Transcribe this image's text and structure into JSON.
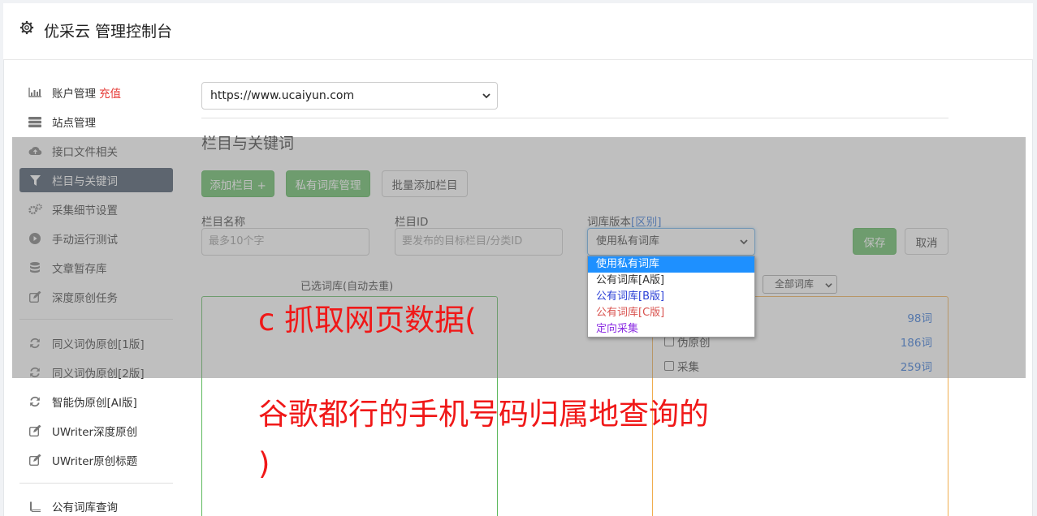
{
  "header": {
    "title": "优采云 管理控制台"
  },
  "sidebar": {
    "items": [
      {
        "label": "账户管理",
        "extra": "充值",
        "icon": "bar-chart-icon"
      },
      {
        "label": "站点管理",
        "icon": "server-icon"
      },
      {
        "label": "接口文件相关",
        "icon": "cloud-upload-icon"
      },
      {
        "label": "栏目与关键词",
        "icon": "filter-icon",
        "active": true
      },
      {
        "label": "采集细节设置",
        "icon": "gears-icon"
      },
      {
        "label": "手动运行测试",
        "icon": "play-circle-icon"
      },
      {
        "label": "文章暂存库",
        "icon": "database-icon"
      },
      {
        "label": "深度原创任务",
        "icon": "edit-icon"
      },
      {
        "label": "同义词伪原创[1版]",
        "icon": "refresh-icon"
      },
      {
        "label": "同义词伪原创[2版]",
        "icon": "refresh-icon"
      },
      {
        "label": "智能伪原创[AI版]",
        "icon": "refresh-icon"
      },
      {
        "label": "UWriter深度原创",
        "icon": "edit-icon"
      },
      {
        "label": "UWriter原创标题",
        "icon": "edit-icon"
      },
      {
        "label": "公有词库查询",
        "icon": "book-icon"
      }
    ]
  },
  "site_select": {
    "value": "https://www.ucaiyun.com"
  },
  "section_title": "栏目与关键词",
  "buttons": {
    "add_column": "添加栏目 +",
    "private_lib": "私有词库管理",
    "batch_add": "批量添加栏目",
    "save": "保存",
    "cancel": "取消"
  },
  "form": {
    "name_label": "栏目名称",
    "name_placeholder": "最多10个字",
    "id_label": "栏目ID",
    "id_placeholder": "要发布的目标栏目/分类ID",
    "version_label": "词库版本",
    "version_label_link": "[区别]",
    "version_value": "使用私有词库"
  },
  "dropdown": {
    "options": [
      {
        "label": "使用私有词库",
        "color": "#ffffff",
        "selected": true
      },
      {
        "label": "公有词库[A版]",
        "color": "#333333"
      },
      {
        "label": "公有词库[B版]",
        "color": "#2a3fd6"
      },
      {
        "label": "公有词库[C版]",
        "color": "#d9534f"
      },
      {
        "label": "定向采集",
        "color": "#8a2be2"
      }
    ]
  },
  "lists": {
    "left_title": "已选词库(自动去重)",
    "filter_value": "全部词库",
    "right_rows": [
      {
        "label": "",
        "count": "98词"
      },
      {
        "label": "伪原创",
        "count": "186词"
      },
      {
        "label": "采集",
        "count": "259词"
      }
    ]
  },
  "overlay_text": {
    "line1": "c 抓取网页数据(",
    "line2": "谷歌都行的手机号码归属地查询的",
    "line3": ")"
  }
}
